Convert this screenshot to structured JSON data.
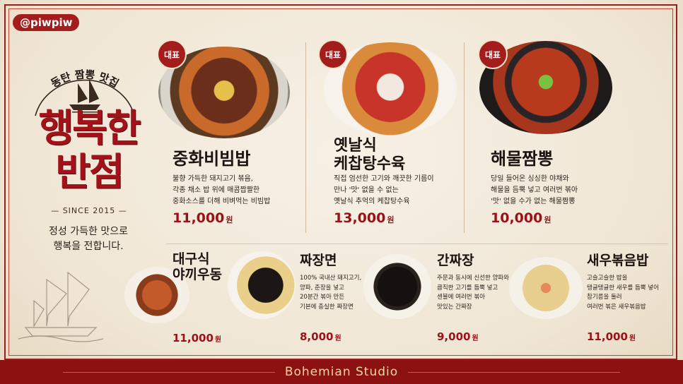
{
  "header": {
    "handle": "@piwpiw"
  },
  "brand": {
    "arch_text": "동탄 짬뽕 맛집",
    "title_line1": "행복한",
    "title_line2": "반점",
    "since": "— SINCE 2015 —",
    "slogan_line1": "정성 가득한 맛으로",
    "slogan_line2": "행복을 전합니다."
  },
  "featured": [
    {
      "badge": "대표",
      "name_line1": "중화비빔밥",
      "name_line2": "",
      "desc": [
        "불향 가득한 돼지고기 볶음,",
        "각종 채소 밥 위에 매콤짭짤한",
        "중화소스를 더해 비벼먹는 비빔밥"
      ],
      "price": "11,000",
      "unit": "원"
    },
    {
      "badge": "대표",
      "name_line1": "옛날식",
      "name_line2": "케찹탕수육",
      "desc": [
        "직접 엄선한 고기와 깨끗한 기름이",
        "만나 '맛' 없을 수 없는",
        "옛날식 추억의 케찹탕수육"
      ],
      "price": "13,000",
      "unit": "원"
    },
    {
      "badge": "대표",
      "name_line1": "해물짬뽕",
      "name_line2": "",
      "desc": [
        "당일 들어온 싱싱한 야채와",
        "해물을 듬뿍 넣고 여러번 볶아",
        "'맛' 없을 수가 없는 해물짬뽕"
      ],
      "price": "10,000",
      "unit": "원"
    }
  ],
  "menu": [
    {
      "name_line1": "대구식",
      "name_line2": "야끼우동",
      "desc": [],
      "price": "11,000",
      "unit": "원"
    },
    {
      "name_line1": "짜장면",
      "name_line2": "",
      "desc": [
        "100% 국내산 돼지고기,",
        "양파, 춘장을 넣고",
        "20분간 볶아 만든",
        "기본에 충실한 짜장면"
      ],
      "price": "8,000",
      "unit": "원"
    },
    {
      "name_line1": "간짜장",
      "name_line2": "",
      "desc": [
        "주문과 동시에 신선한 양파와",
        "큼직한 고기를 듬뿍 넣고",
        "센불에 여러번 볶아",
        "맛있는 간짜장"
      ],
      "price": "9,000",
      "unit": "원"
    },
    {
      "name_line1": "새우볶음밥",
      "name_line2": "",
      "desc": [
        "고슬고슬한 밥을",
        "탱글탱글한 새우를 듬뿍 넣어",
        "참기름을 둘러",
        "여러번 볶은 새우볶음밥"
      ],
      "price": "11,000",
      "unit": "원"
    }
  ],
  "footer": {
    "brand": "Bohemian Studio"
  },
  "colors": {
    "accent": "#a41d1d",
    "background": "#efe6d6",
    "text": "#1c1410"
  }
}
